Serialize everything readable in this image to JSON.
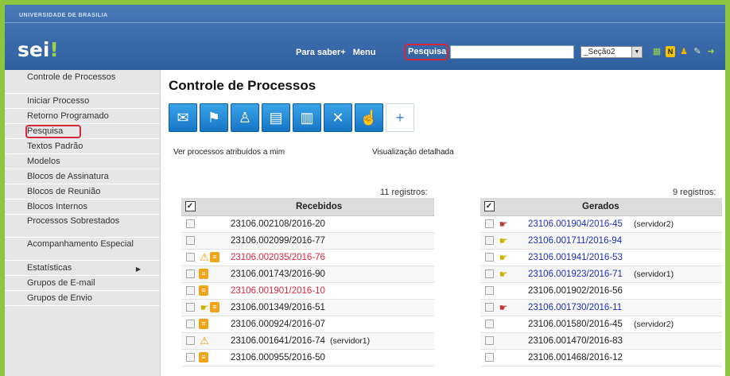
{
  "header": {
    "university": "UNIVERSIDADE DE BRASILIA",
    "logo_main": "sei",
    "logo_accent": "!",
    "nav_para_saber": "Para saber+",
    "nav_menu": "Menu",
    "nav_pesquisa": "Pesquisa",
    "search_value": "",
    "unit_select": "_Seção2",
    "icons": [
      "grid-icon",
      "n-icon",
      "person-icon",
      "wrench-icon",
      "exit-icon"
    ]
  },
  "sidebar": {
    "items": [
      {
        "label": "Controle de Processos",
        "two_line": true
      },
      {
        "label": "Iniciar Processo"
      },
      {
        "label": "Retorno Programado"
      },
      {
        "label": "Pesquisa",
        "highlighted": true
      },
      {
        "label": "Textos Padrão"
      },
      {
        "label": "Modelos"
      },
      {
        "label": "Blocos de Assinatura"
      },
      {
        "label": "Blocos de Reunião"
      },
      {
        "label": "Blocos Internos"
      },
      {
        "label": "Processos Sobrestados",
        "two_line": true
      },
      {
        "label": "Acompanhamento Especial",
        "two_line": true
      },
      {
        "label": "Estatísticas",
        "submenu": true
      },
      {
        "label": "Grupos de E-mail"
      },
      {
        "label": "Grupos de Envio"
      }
    ]
  },
  "main": {
    "title": "Controle de Processos",
    "toolbar": [
      "send-document-icon",
      "assign-icon",
      "person-assign-icon",
      "books-icon",
      "close-process-icon",
      "cancel-icon",
      "follow-icon",
      "new-document-icon"
    ],
    "link_assigned": "Ver processos atribuídos a mim",
    "link_detailed": "Visualização detalhada"
  },
  "recebidos": {
    "count": "11 registros:",
    "header": "Recebidos",
    "rows": [
      {
        "icons": [],
        "number": "23106.002108/2016-20",
        "color": "normal",
        "tag": ""
      },
      {
        "icons": [],
        "number": "23106.002099/2016-77",
        "color": "normal",
        "tag": ""
      },
      {
        "icons": [
          "warn",
          "note"
        ],
        "number": "23106.002035/2016-76",
        "color": "red",
        "tag": ""
      },
      {
        "icons": [
          "note"
        ],
        "number": "23106.001743/2016-90",
        "color": "normal",
        "tag": ""
      },
      {
        "icons": [
          "note"
        ],
        "number": "23106.001901/2016-10",
        "color": "red",
        "tag": ""
      },
      {
        "icons": [
          "hand-y",
          "note"
        ],
        "number": "23106.001349/2016-51",
        "color": "normal",
        "tag": ""
      },
      {
        "icons": [
          "note"
        ],
        "number": "23106.000924/2016-07",
        "color": "normal",
        "tag": ""
      },
      {
        "icons": [
          "warn"
        ],
        "number": "23106.001641/2016-74",
        "color": "normal",
        "tag": "(servidor1)"
      },
      {
        "icons": [
          "note"
        ],
        "number": "23106.000955/2016-50",
        "color": "normal",
        "tag": ""
      }
    ]
  },
  "gerados": {
    "count": "9 registros:",
    "header": "Gerados",
    "rows": [
      {
        "icons": [
          "hand-r"
        ],
        "number": "23106.001904/2016-45",
        "color": "blue",
        "tag": "(servidor2)"
      },
      {
        "icons": [
          "hand-y"
        ],
        "number": "23106.001711/2016-94",
        "color": "blue",
        "tag": ""
      },
      {
        "icons": [
          "hand-y"
        ],
        "number": "23106.001941/2016-53",
        "color": "blue",
        "tag": ""
      },
      {
        "icons": [
          "hand-y"
        ],
        "number": "23106.001923/2016-71",
        "color": "blue",
        "tag": "(servidor1)"
      },
      {
        "icons": [],
        "number": "23106.001902/2016-56",
        "color": "normal",
        "tag": ""
      },
      {
        "icons": [
          "hand-r"
        ],
        "number": "23106.001730/2016-11",
        "color": "blue",
        "tag": ""
      },
      {
        "icons": [],
        "number": "23106.001580/2016-45",
        "color": "normal",
        "tag": "(servidor2)"
      },
      {
        "icons": [],
        "number": "23106.001470/2016-83",
        "color": "normal",
        "tag": ""
      },
      {
        "icons": [],
        "number": "23106.001468/2016-12",
        "color": "normal",
        "tag": ""
      }
    ]
  },
  "colors": {
    "frame": "#8cc63f",
    "topbar": "#3a6aab",
    "highlight": "#d6263a",
    "red_proc": "#e0243a",
    "blue_proc": "#1e2fc0"
  }
}
